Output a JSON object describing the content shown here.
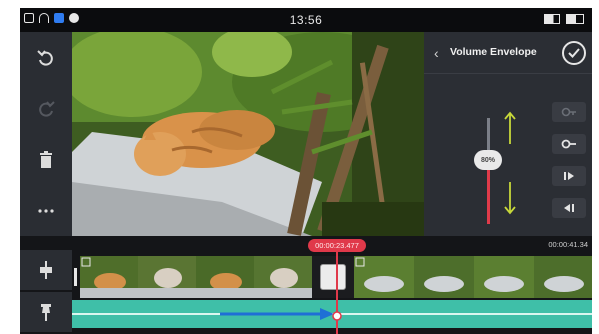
{
  "status_bar": {
    "time": "13:56"
  },
  "left_toolbar": {
    "items": [
      {
        "name": "undo",
        "icon": "undo-icon"
      },
      {
        "name": "redo",
        "icon": "redo-icon"
      },
      {
        "name": "delete",
        "icon": "trash-icon"
      },
      {
        "name": "more",
        "icon": "more-icon"
      }
    ]
  },
  "panel": {
    "title": "Volume Envelope",
    "slider_label": "80%",
    "slider_level": 0.55,
    "buttons": [
      {
        "name": "add-keyframe",
        "icon": "key-icon"
      },
      {
        "name": "remove-keyframe",
        "icon": "key-remove-icon"
      },
      {
        "name": "next-keyframe",
        "icon": "next-keyframe-icon"
      },
      {
        "name": "prev-keyframe",
        "icon": "prev-keyframe-icon"
      }
    ]
  },
  "timeline": {
    "playhead_time": "00:00:23.477",
    "total_time": "00:00:41.34",
    "left_tools": [
      {
        "name": "split",
        "icon": "split-icon"
      },
      {
        "name": "pin",
        "icon": "pin-icon"
      }
    ]
  },
  "colors": {
    "accent": "#e0394a",
    "audio": "#3fbfa8",
    "panel": "#2b2e34",
    "arrow": "#1f6fd6"
  }
}
